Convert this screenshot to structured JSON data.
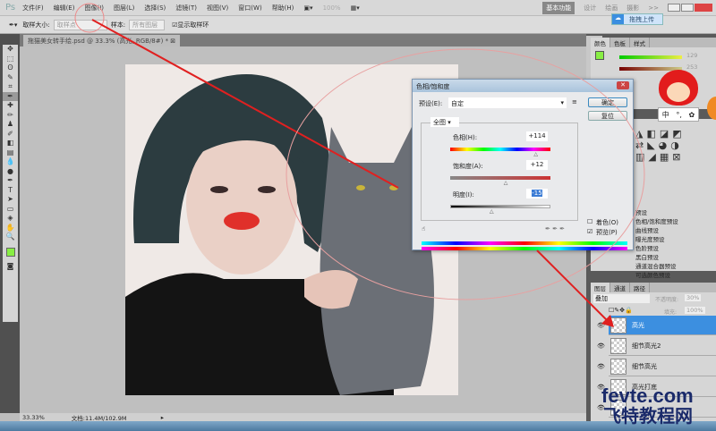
{
  "app": {
    "logo": "Ps",
    "menu": [
      "文件(F)",
      "编辑(E)",
      "图像(I)",
      "图层(L)",
      "选择(S)",
      "滤镜(T)",
      "视图(V)",
      "窗口(W)",
      "帮助(H)"
    ],
    "zoom": "100%",
    "workspaces": [
      "基本功能",
      "设计",
      "绘画",
      "摄影",
      ">>"
    ],
    "upload_label": "拖拽上传"
  },
  "options": {
    "sample_size_label": "取样大小:",
    "sample_size": "取样点",
    "sample_label": "样本:",
    "sample": "所有图层",
    "show_ring": "显示取样环"
  },
  "document": {
    "tab": "拖猫美女转手绘.psd @ 33.3% (高光, RGB/8#) *",
    "zoom": "33.33%",
    "doc_info": "文档:11.4M/102.9M"
  },
  "color_panel": {
    "tabs": [
      "颜色",
      "色板",
      "样式"
    ],
    "values": [
      "129",
      "253"
    ],
    "fg": "#88ee44"
  },
  "dialog": {
    "title": "色相/饱和度",
    "preset_label": "预设(E):",
    "preset": "自定",
    "ok": "确定",
    "reset": "复位",
    "channel": "全图",
    "hue_label": "色相(H):",
    "hue": "+114",
    "hue_fraction": 0.86,
    "sat_label": "饱和度(A):",
    "sat": "+12",
    "sat_fraction": 0.56,
    "light_label": "明度(I):",
    "light": "-15",
    "light_fraction": 0.42,
    "colorize": "着色(O)",
    "preview": "预览(P)",
    "preview_checked": true
  },
  "adjust_list": [
    "预设",
    "色相/饱和度预设",
    "曲线预设",
    "曝光度预设",
    "色阶预设",
    "黑白预设",
    "通道混合器预设",
    "可选颜色预设"
  ],
  "layers_panel": {
    "tabs": [
      "图层",
      "通道",
      "路径"
    ],
    "blend": "叠加",
    "opacity_label": "不透明度:",
    "opacity": "30%",
    "fill_label": "填充:",
    "fill": "100%",
    "layers": [
      "高光",
      "细节高光2",
      "细节高光",
      "高光打底",
      ""
    ],
    "selected": 0
  },
  "mascot_menu": [
    "中",
    "°,",
    "✿"
  ],
  "watermark": {
    "en": "fevte.com",
    "cn": "飞特教程网"
  },
  "accent": "#e02020"
}
